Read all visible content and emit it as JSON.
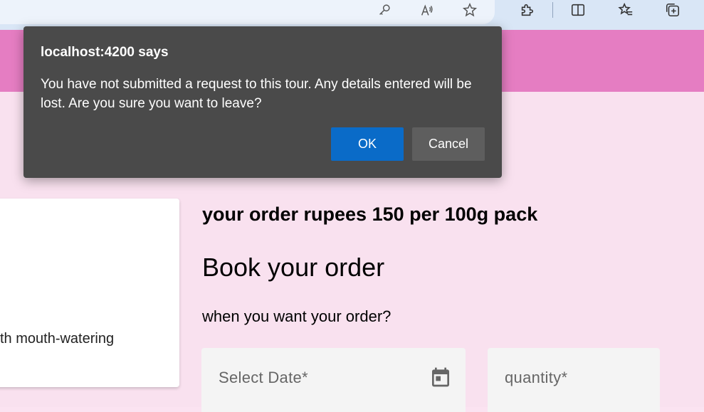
{
  "browser_toolbar": {
    "icons": [
      "key-icon",
      "read-aloud-icon",
      "favorite-star-icon",
      "extensions-icon",
      "split-screen-icon",
      "favorites-icon",
      "collections-icon"
    ]
  },
  "colors": {
    "header": "#e57dc2",
    "page_background": "#f9e1ef",
    "dialog_background": "#4a4a4a",
    "ok_button": "#0a6bc8",
    "cancel_button": "#5e5e5e"
  },
  "dialog": {
    "title": "localhost:4200 says",
    "message": "You have not submitted a request to this tour. Any details entered will be lost. Are you sure you want to leave?",
    "ok_label": "OK",
    "cancel_label": "Cancel"
  },
  "product_card": {
    "description": "th mouth-watering"
  },
  "booking": {
    "price_text": "your order rupees 150 per 100g pack",
    "title": "Book your order",
    "prompt": "when you want your order?",
    "date_placeholder": "Select Date*",
    "quantity_placeholder": "quantity*"
  }
}
